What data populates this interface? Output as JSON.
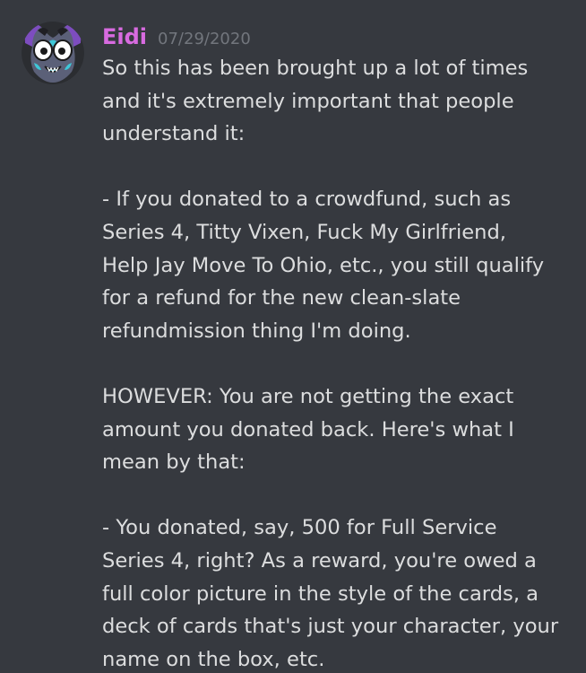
{
  "message": {
    "author": "Eidi",
    "timestamp": "07/29/2020",
    "author_color": "#d86be0",
    "avatar_icon": "character-avatar-icon",
    "paragraphs": [
      {
        "lines": [
          "So this has been brought up a lot of times",
          "and it's extremely important that people",
          "understand it:"
        ]
      },
      {
        "lines": [
          "- If you donated to a crowdfund, such as",
          "Series 4, Titty Vixen, Fuck My Girlfriend,",
          "Help Jay Move To Ohio, etc., you still qualify",
          "for a refund for the new clean-slate",
          "refundmission thing I'm doing."
        ]
      },
      {
        "lines": [
          "HOWEVER: You are not getting the exact",
          "amount you donated back. Here's what I",
          "mean by that:"
        ]
      },
      {
        "lines": [
          "- You donated, say, 500 for Full Service",
          "Series 4, right? As a reward, you're owed a",
          "full color picture in the style of the cards, a",
          "deck of cards that's just your character, your",
          "name on the box, etc."
        ]
      }
    ]
  }
}
